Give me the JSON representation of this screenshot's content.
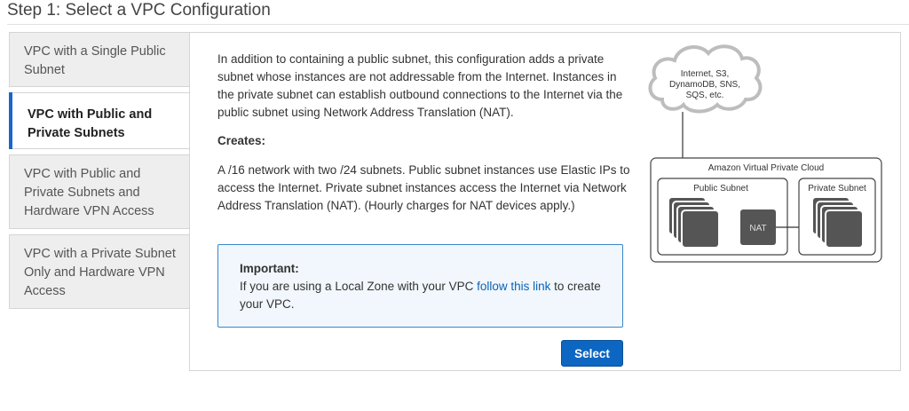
{
  "page": {
    "step_title": "Step 1: Select a VPC Configuration"
  },
  "tabs": [
    {
      "label": "VPC with a Single Public Subnet"
    },
    {
      "label": "VPC with Public and Private Subnets"
    },
    {
      "label": "VPC with Public and Private Subnets and Hardware VPN Access"
    },
    {
      "label": "VPC with a Private Subnet Only and Hardware VPN Access"
    }
  ],
  "content": {
    "description": "In addition to containing a public subnet, this configuration adds a private subnet whose instances are not addressable from the Internet. Instances in the private subnet can establish outbound connections to the Internet via the public subnet using Network Address Translation (NAT).",
    "creates_heading": "Creates:",
    "creates_text": "A /16 network with two /24 subnets. Public subnet instances use Elastic IPs to access the Internet. Private subnet instances access the Internet via Network Address Translation (NAT). (Hourly charges for NAT devices apply.)",
    "notice": {
      "title": "Important:",
      "text_before": "If you are using a Local Zone with your VPC ",
      "link": "follow this link",
      "text_after": " to create your VPC."
    },
    "select_button": "Select"
  },
  "diagram": {
    "cloud_lines": [
      "Internet, S3,",
      "DynamoDB, SNS,",
      "SQS, etc."
    ],
    "vpc_label": "Amazon Virtual Private Cloud",
    "public_subnet_label": "Public Subnet",
    "private_subnet_label": "Private Subnet",
    "nat_label": "NAT"
  },
  "colors": {
    "accent": "#0d66c2",
    "active_tab_bar": "#1b66c9",
    "notice_bg": "#f1f7fc",
    "notice_border": "#3a87c8"
  }
}
